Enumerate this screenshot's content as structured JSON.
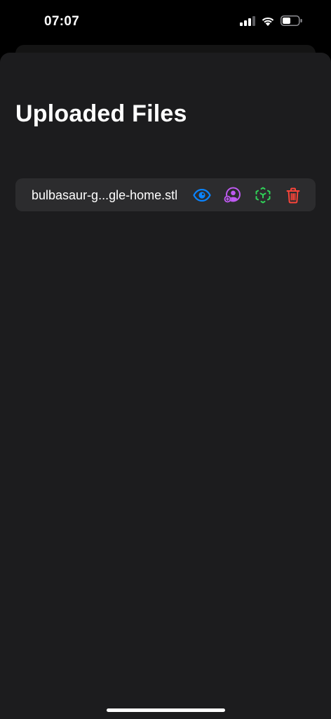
{
  "status_bar": {
    "time": "07:07",
    "icons": [
      "cellular-signal-icon",
      "wifi-icon",
      "battery-icon"
    ]
  },
  "page": {
    "title": "Uploaded Files"
  },
  "files": [
    {
      "name": "bulbasaur-g...gle-home.stl",
      "actions": [
        {
          "icon": "eye-icon",
          "color": "#0a84ff"
        },
        {
          "icon": "user-add-icon",
          "color": "#bf5af2"
        },
        {
          "icon": "scan-cube-icon",
          "color": "#30d158"
        },
        {
          "icon": "trash-icon",
          "color": "#ff453a"
        }
      ]
    }
  ]
}
